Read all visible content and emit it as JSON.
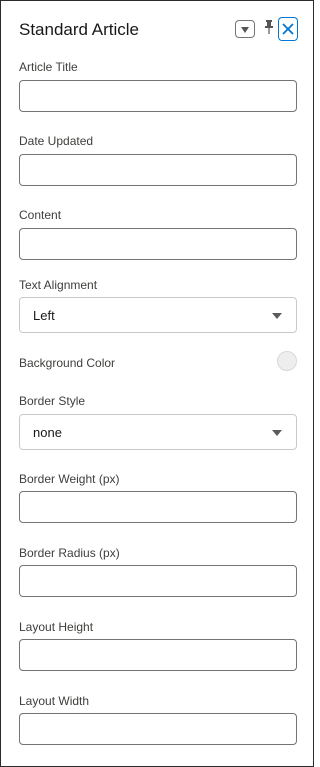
{
  "header": {
    "title": "Standard Article"
  },
  "fields": {
    "article_title": {
      "label": "Article Title",
      "value": ""
    },
    "date_updated": {
      "label": "Date Updated",
      "value": ""
    },
    "content": {
      "label": "Content",
      "value": ""
    },
    "text_alignment": {
      "label": "Text Alignment",
      "value": "Left"
    },
    "background_color": {
      "label": "Background Color",
      "swatch_color": "#eeeeee"
    },
    "border_style": {
      "label": "Border Style",
      "value": "none"
    },
    "border_weight": {
      "label": "Border Weight (px)",
      "value": ""
    },
    "border_radius": {
      "label": "Border Radius (px)",
      "value": ""
    },
    "layout_height": {
      "label": "Layout Height",
      "value": ""
    },
    "layout_width": {
      "label": "Layout Width",
      "value": ""
    }
  },
  "icons": {
    "menu": "chevron-down-icon",
    "pin": "pin-icon",
    "close": "close-icon"
  },
  "colors": {
    "accent": "#0176d3",
    "border": "#747474"
  }
}
